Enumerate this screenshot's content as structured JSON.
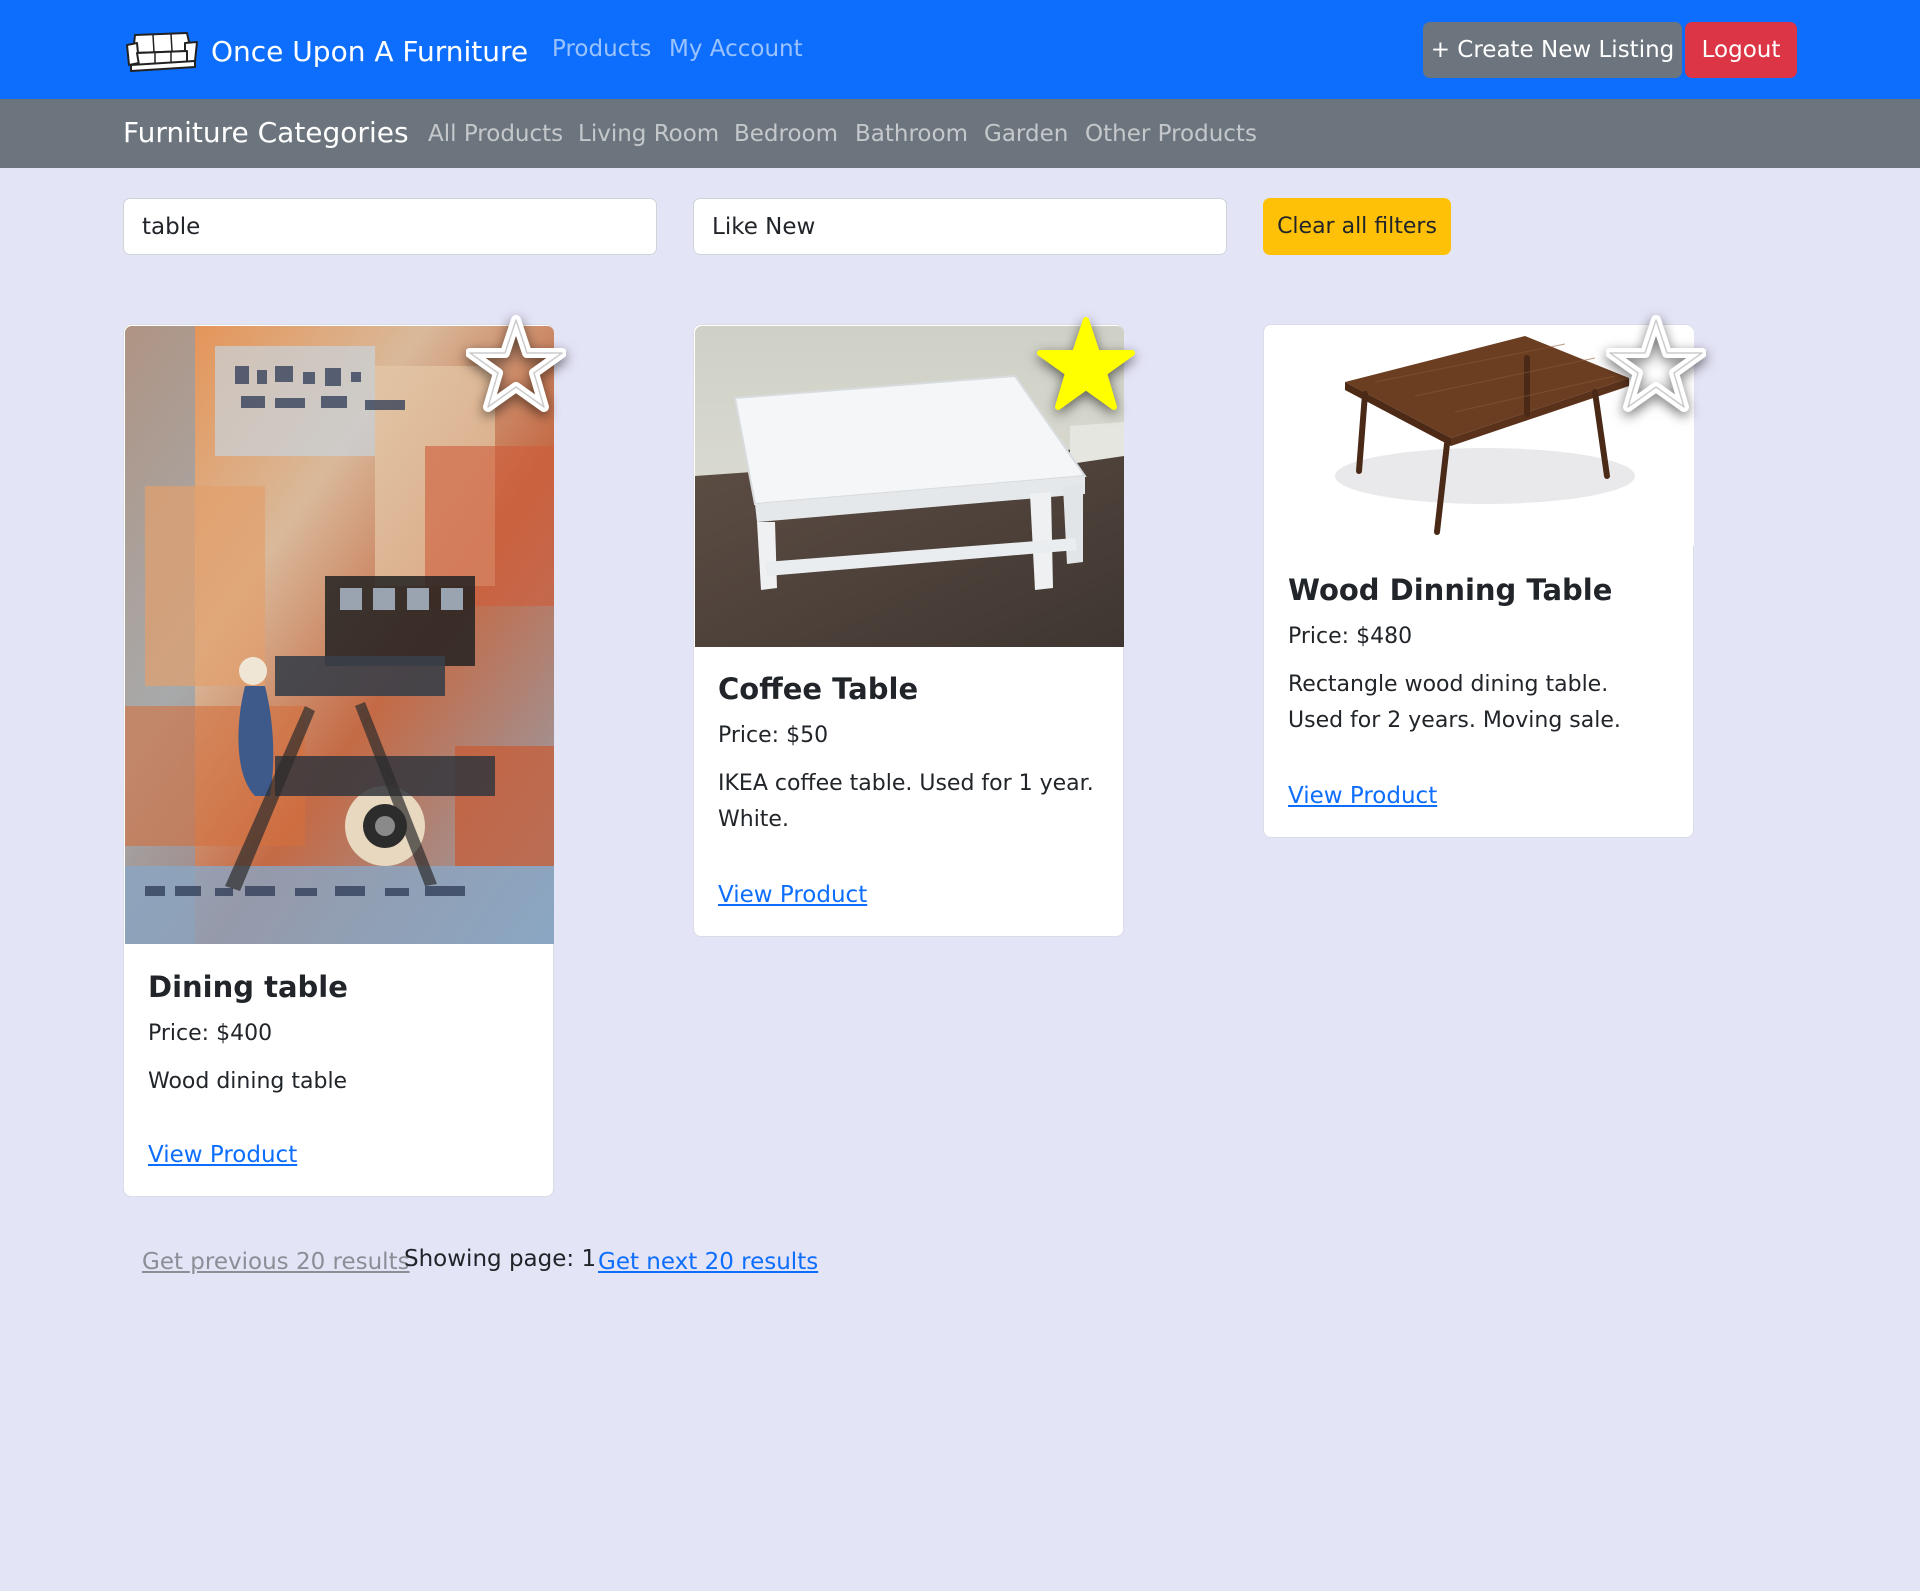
{
  "navbar": {
    "brand": "Once Upon A Furniture",
    "brand_icon": "sofa-logo",
    "links": [
      "Products",
      "My Account"
    ],
    "create_label": "+ Create New Listing",
    "logout_label": "Logout"
  },
  "categories": {
    "title": "Furniture Categories",
    "links": [
      "All Products",
      "Living Room",
      "Bedroom",
      "Bathroom",
      "Garden",
      "Other Products"
    ]
  },
  "filters": {
    "search_value": "table",
    "condition_value": "Like New",
    "clear_label": "Clear all filters",
    "clear_color": "#ffc107"
  },
  "products": [
    {
      "title": "Dining table",
      "price": "Price: $400",
      "description": "Wood dining table",
      "link": "View Product",
      "favorite": false,
      "image": "abstract-art-image"
    },
    {
      "title": "Coffee Table",
      "price": "Price: $50",
      "description": "IKEA coffee table. Used for 1 year. White.",
      "link": "View Product",
      "favorite": true,
      "image": "white-coffee-table-photo"
    },
    {
      "title": "Wood Dinning Table",
      "price": "Price: $480",
      "description": "Rectangle wood dining table. Used for 2 years. Moving sale.",
      "link": "View Product",
      "favorite": false,
      "image": "wood-table-photo"
    }
  ],
  "pagination": {
    "prev_label": "Get previous 20 results",
    "page_info": "Showing page: 1",
    "next_label": "Get next 20 results"
  },
  "colors": {
    "primary": "#0d6efd",
    "secondary": "#6c757d",
    "danger": "#dc3545",
    "page_bg": "#e4e4f7",
    "favorite_star": "#ffff00"
  }
}
